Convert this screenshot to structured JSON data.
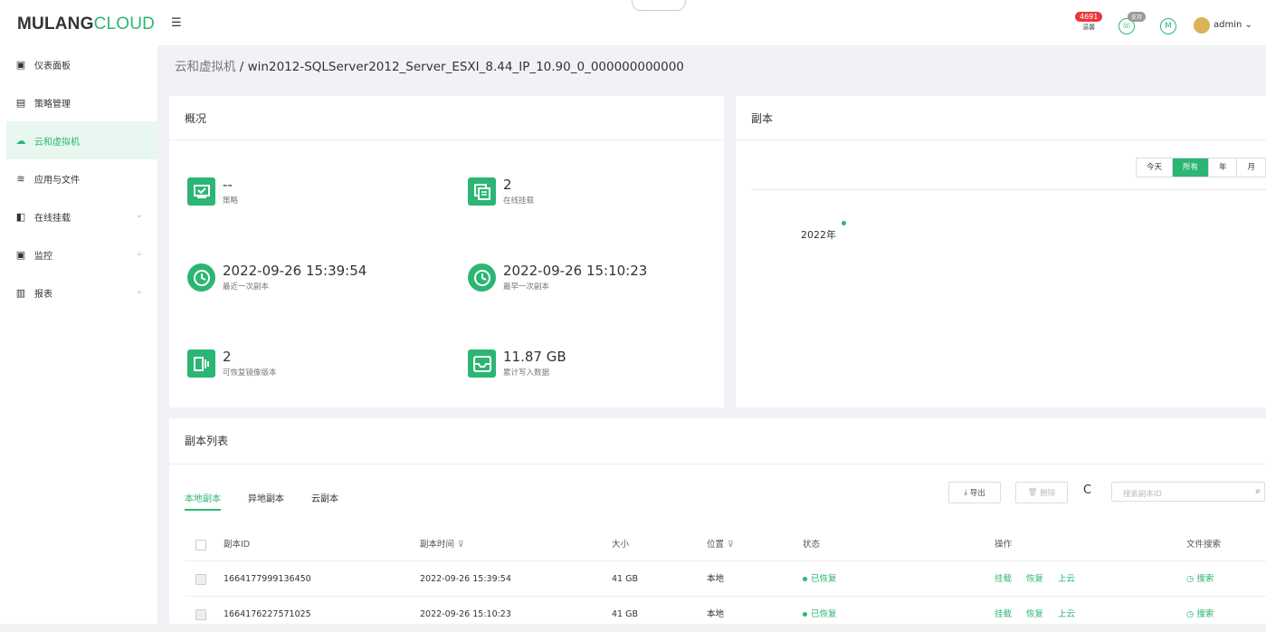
{
  "brand": {
    "logo_part1": "MULANG",
    "logo_part2": "CLOUD"
  },
  "sidebar": {
    "items": [
      {
        "label": "仪表面板",
        "icon": "dashboard-icon",
        "glyph": "▣"
      },
      {
        "label": "策略管理",
        "icon": "policy-icon",
        "glyph": "▤"
      },
      {
        "label": "云和虚拟机",
        "icon": "cloud-vm-icon",
        "glyph": "☁"
      },
      {
        "label": "应用与文件",
        "icon": "layers-icon",
        "glyph": "≋"
      },
      {
        "label": "在线挂载",
        "icon": "mount-icon",
        "glyph": "◧"
      },
      {
        "label": "监控",
        "icon": "monitor-icon",
        "glyph": "▣"
      },
      {
        "label": "报表",
        "icon": "report-icon",
        "glyph": "▥"
      }
    ]
  },
  "header": {
    "alarm_count": "4691",
    "alarm_label": "温馨",
    "service_badge": "支持",
    "m_icon": "M",
    "user": "admin"
  },
  "breadcrumb": {
    "parent": "云和虚拟机",
    "sep": " / ",
    "current": "win2012-SQLServer2012_Server_ESXI_8.44_IP_10.90_0_000000000000"
  },
  "overview": {
    "title": "概况",
    "stats": [
      {
        "value": "--",
        "label": "策略",
        "icon": "monitor-check-icon"
      },
      {
        "value": "2",
        "label": "在线挂载",
        "icon": "mount-copy-icon"
      },
      {
        "value": "2022-09-26 15:39:54",
        "label": "最近一次副本",
        "icon": "clock-icon"
      },
      {
        "value": "2022-09-26 15:10:23",
        "label": "最早一次副本",
        "icon": "clock-icon"
      },
      {
        "value": "2",
        "label": "可恢复镜像版本",
        "icon": "image-version-icon"
      },
      {
        "value": "11.87 GB",
        "label": "累计写入数据",
        "icon": "storage-icon"
      }
    ]
  },
  "copies_panel": {
    "title": "副本",
    "range": [
      "今天",
      "所有",
      "年",
      "月"
    ],
    "range_selected": "所有",
    "timeline_year": "2022年"
  },
  "copy_list": {
    "title": "副本列表",
    "tabs": [
      "本地副本",
      "异地副本",
      "云副本"
    ],
    "active_tab": "本地副本",
    "export_label": "导出",
    "delete_label": "删除",
    "refresh_glyph": "C",
    "search_placeholder": "搜索副本ID",
    "columns": [
      "副本ID",
      "副本时间",
      "大小",
      "位置",
      "状态",
      "操作",
      "文件搜索"
    ],
    "rows": [
      {
        "id": "1664177999136450",
        "time": "2022-09-26 15:39:54",
        "size": "41 GB",
        "location": "本地",
        "status": "已恢复",
        "actions": [
          "挂载",
          "恢复",
          "上云"
        ],
        "file_search": "搜索"
      },
      {
        "id": "1664176227571025",
        "time": "2022-09-26 15:10:23",
        "size": "41 GB",
        "location": "本地",
        "status": "已恢复",
        "actions": [
          "挂载",
          "恢复",
          "上云"
        ],
        "file_search": "搜索"
      }
    ]
  },
  "colors": {
    "accent": "#2bb673",
    "alarm": "#e8383d"
  }
}
